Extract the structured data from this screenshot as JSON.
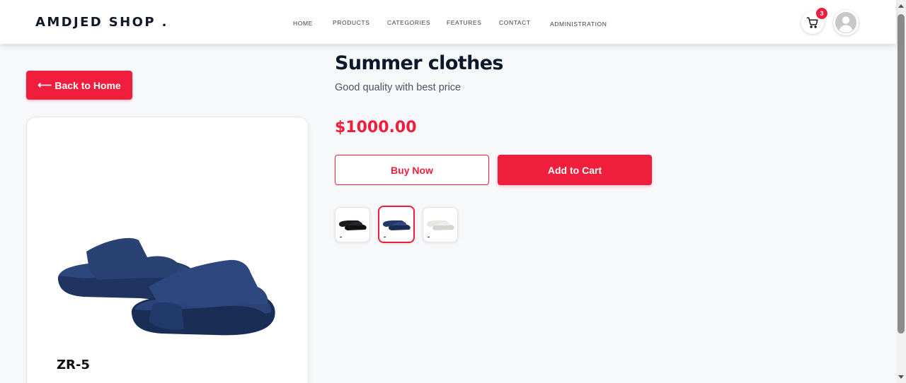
{
  "header": {
    "brand": "AMDJED SHOP .",
    "nav": [
      {
        "label": "HOME"
      },
      {
        "label": "PRODUCTS"
      },
      {
        "label": "CATEGORIES"
      },
      {
        "label": "FEATURES"
      },
      {
        "label": "CONTACT"
      },
      {
        "label": "ADMINISTRATION"
      }
    ],
    "cart_count": "3"
  },
  "back_button": {
    "arrow": "⟵",
    "label": "Back to Home"
  },
  "product": {
    "title": "Summer clothes",
    "subtitle": "Good quality with best price",
    "price": "$1000.00",
    "buy_now_label": "Buy Now",
    "add_to_cart_label": "Add to Cart",
    "model_label": "ZR-5",
    "variants": [
      {
        "color_name": "black",
        "color": "#1b1b1d",
        "selected": false
      },
      {
        "color_name": "navy",
        "color": "#24386a",
        "selected": true
      },
      {
        "color_name": "white",
        "color": "#e6e6e3",
        "selected": false
      }
    ]
  },
  "colors": {
    "accent": "#ef1e3c",
    "title": "#0f172a",
    "slipper_navy": "#2a4173"
  },
  "icons": [
    "cart-icon",
    "user-avatar-icon",
    "arrow-left-icon"
  ]
}
